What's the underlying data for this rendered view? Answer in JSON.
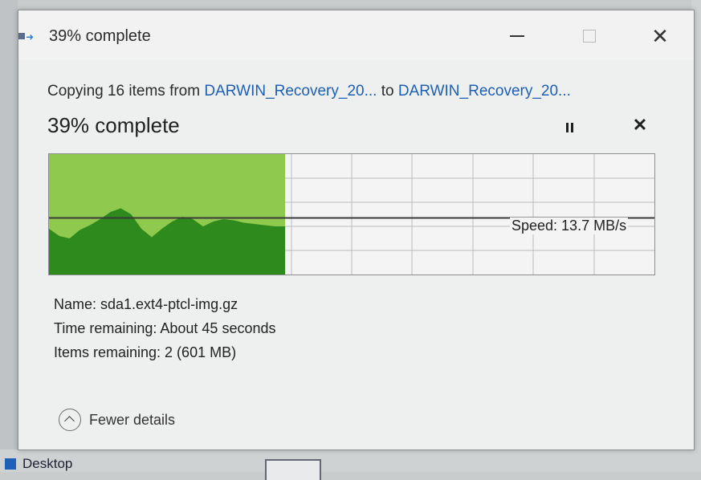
{
  "window": {
    "title": "39% complete",
    "minimize_label": "—",
    "close_label": "✕"
  },
  "header": {
    "copying_prefix": "Copying 16 items from ",
    "source": "DARWIN_Recovery_20...",
    "connector": " to ",
    "destination": "DARWIN_Recovery_20...",
    "percent_text": "39% complete"
  },
  "progress": {
    "fraction": 0.39,
    "speed_text": "Speed: 13.7 MB/s",
    "current_speed_level": 0.47,
    "history_levels": [
      0.38,
      0.32,
      0.3,
      0.37,
      0.41,
      0.46,
      0.52,
      0.55,
      0.5,
      0.38,
      0.31,
      0.38,
      0.44,
      0.48,
      0.46,
      0.4,
      0.44,
      0.46,
      0.45,
      0.43,
      0.42,
      0.41,
      0.4,
      0.4
    ],
    "colors": {
      "fill_light": "#8fc94e",
      "fill_dark": "#2f8a1e",
      "speed_line": "#3a3a3a",
      "grid": "#b9bdbf"
    }
  },
  "details": {
    "name_text": "Name: sda1.ext4-ptcl-img.gz",
    "time_text": "Time remaining: About 45 seconds",
    "items_text": "Items remaining: 2 (601 MB)"
  },
  "footer": {
    "toggle_label": "Fewer details",
    "toggle_icon": "chevron-up-icon"
  },
  "desktop": {
    "label": "Desktop"
  }
}
